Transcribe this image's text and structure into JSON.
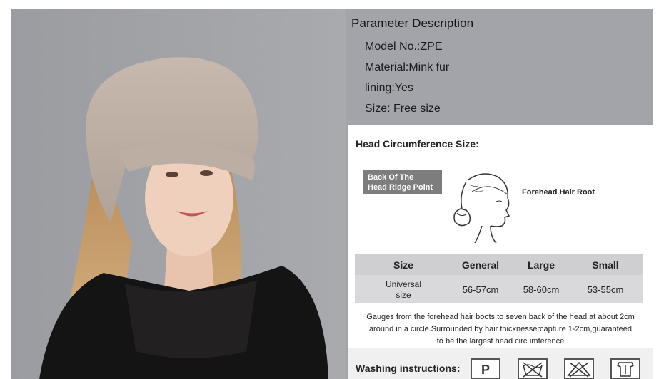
{
  "parameters": {
    "title": "Parameter Description",
    "items": [
      "Model No.:ZPE",
      "Material:Mink fur",
      "lining:Yes",
      "Size: Free size"
    ]
  },
  "head_size": {
    "title": "Head Circumference Size:",
    "back_label_line1": "Back Of The",
    "back_label_line2": "Head Ridge Point",
    "forehead_label": "Forehead Hair Root"
  },
  "size_table": {
    "headers": [
      "Size",
      "General",
      "Large",
      "Small"
    ],
    "row_label_line1": "Universal",
    "row_label_line2": "size",
    "values": [
      "56-57cm",
      "58-60cm",
      "53-55cm"
    ]
  },
  "gauge_note": {
    "line1": "Gauges from the forehead hair boots,to seven back of the head at about 2cm",
    "line2": "around in a circle.Surrounded by hair thicknessercapture 1-2cm,guaranteed",
    "line3": "to be the largest head circumference"
  },
  "washing": {
    "title": "Washing instructions:",
    "icons": [
      "dry-clean-p-icon",
      "do-not-wash-icon",
      "do-not-bleach-icon",
      "hang-dry-icon"
    ],
    "p_letter": "P"
  },
  "colors": {
    "panel_background": "#a3a4a9",
    "card_background": "#ffffff",
    "table_header": "#cfcfd1",
    "back_label": "#7d7d7d"
  }
}
